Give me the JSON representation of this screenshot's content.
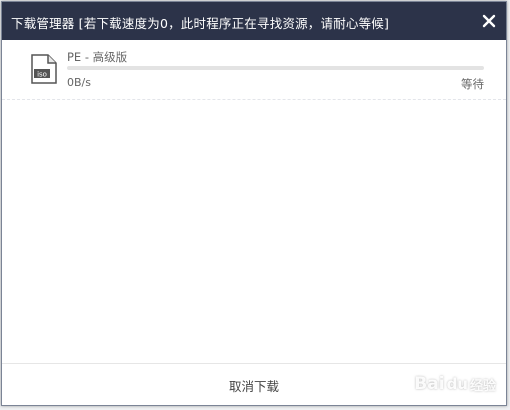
{
  "dialog": {
    "title": "下载管理器 [若下载速度为0，此时程序正在寻找资源，请耐心等候]",
    "close_icon": "close-icon"
  },
  "downloads": [
    {
      "file_icon": "iso-file-icon",
      "file_icon_label": "iso",
      "name": "PE - 高级版",
      "progress_percent": 0,
      "speed": "0B/s",
      "status": "等待"
    }
  ],
  "footer": {
    "cancel_label": "取消下载"
  },
  "watermark": {
    "brand": "Bai",
    "paw": "du",
    "suffix": "经验"
  },
  "colors": {
    "titlebar": "#2c3349",
    "progress_track": "#e3e3e3",
    "progress_fill": "#3c8fe0",
    "text": "#666666"
  }
}
